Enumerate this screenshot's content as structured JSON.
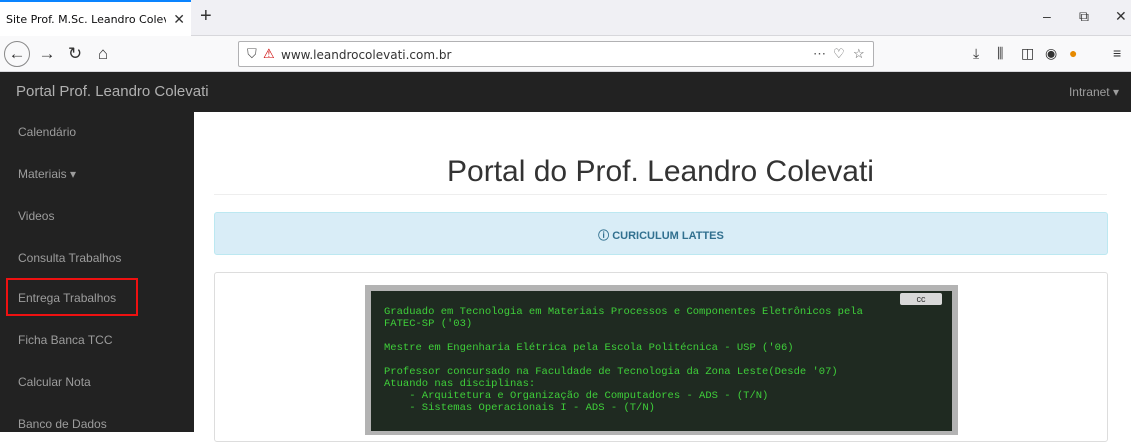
{
  "browser": {
    "tab_title": "Site Prof. M.Sc. Leandro Colevati d",
    "tab_close": "✕",
    "new_tab": "+",
    "url": "www.leandrocolevati.com.br",
    "window_controls": [
      "–",
      "⧉",
      "✕"
    ]
  },
  "site": {
    "brand": "Portal Prof. Leandro Colevati",
    "intranet": "Intranet ▾"
  },
  "sidebar": {
    "items": [
      {
        "label": "Calendário"
      },
      {
        "label": "Materiais ▾"
      },
      {
        "label": "Videos"
      },
      {
        "label": "Consulta Trabalhos"
      },
      {
        "label": "Entrega Trabalhos",
        "highlighted": true
      },
      {
        "label": "Ficha Banca TCC"
      },
      {
        "label": "Calcular Nota"
      },
      {
        "label": "Banco de Dados"
      }
    ]
  },
  "main": {
    "title": "Portal do Prof. Leandro Colevati",
    "lattes": "CURICULUM LATTES",
    "chalk_badge": "cc",
    "chalk_lines": [
      "Graduado em Tecnologia em Materiais Processos e Componentes Eletrônicos pela",
      "FATEC-SP ('03)",
      "Mestre em Engenharia Elétrica pela Escola Politécnica - USP ('06)",
      "Professor concursado na Faculdade de Tecnologia da Zona Leste(Desde '07)",
      "Atuando nas disciplinas:",
      "    - Arquitetura e Organização de Computadores - ADS - (T/N)",
      "    - Sistemas Operacionais I - ADS - (T/N)"
    ]
  },
  "colors": {
    "dark_bg": "#222222",
    "highlight": "#ee1111",
    "info_bg": "#d9edf7",
    "chalk_text": "#3fcf3a"
  }
}
